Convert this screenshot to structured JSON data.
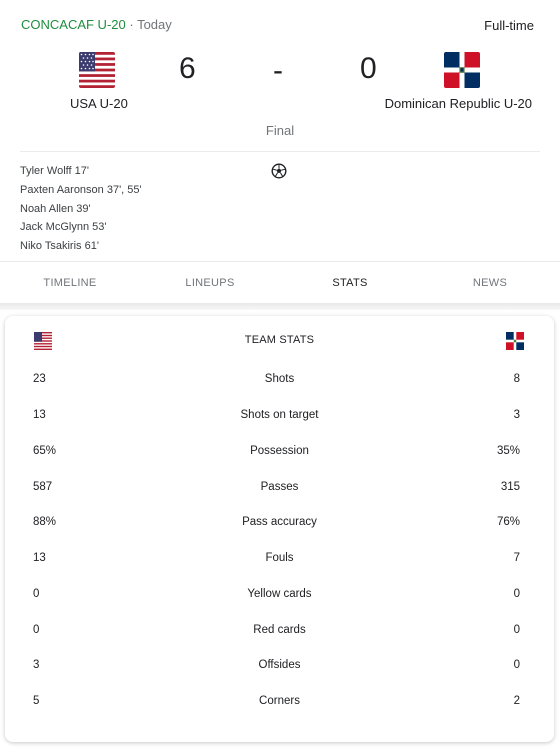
{
  "header": {
    "competition": "CONCACAF U-20",
    "separator": " · ",
    "date": "Today",
    "status": "Full-time"
  },
  "match": {
    "home": {
      "name": "USA U-20",
      "score": "6",
      "flag_icon": "usa-flag-icon"
    },
    "away": {
      "name": "Dominican Republic U-20",
      "score": "0",
      "flag_icon": "dominican-republic-flag-icon"
    },
    "score_separator": "-",
    "result": "Final"
  },
  "scorers": [
    "Tyler Wolff 17'",
    "Paxten Aaronson 37', 55'",
    "Noah Allen 39'",
    "Jack McGlynn 53'",
    "Niko Tsakiris 61'"
  ],
  "tabs": [
    {
      "label": "TIMELINE",
      "active": false
    },
    {
      "label": "LINEUPS",
      "active": false
    },
    {
      "label": "STATS",
      "active": true
    },
    {
      "label": "NEWS",
      "active": false
    }
  ],
  "stats": {
    "title": "TEAM STATS",
    "rows": [
      {
        "home": "23",
        "label": "Shots",
        "away": "8"
      },
      {
        "home": "13",
        "label": "Shots on target",
        "away": "3"
      },
      {
        "home": "65%",
        "label": "Possession",
        "away": "35%"
      },
      {
        "home": "587",
        "label": "Passes",
        "away": "315"
      },
      {
        "home": "88%",
        "label": "Pass accuracy",
        "away": "76%"
      },
      {
        "home": "13",
        "label": "Fouls",
        "away": "7"
      },
      {
        "home": "0",
        "label": "Yellow cards",
        "away": "0"
      },
      {
        "home": "0",
        "label": "Red cards",
        "away": "0"
      },
      {
        "home": "3",
        "label": "Offsides",
        "away": "0"
      },
      {
        "home": "5",
        "label": "Corners",
        "away": "2"
      }
    ]
  },
  "colors": {
    "competition": "#1e8e3e",
    "muted": "#70757a",
    "text": "#202124"
  }
}
